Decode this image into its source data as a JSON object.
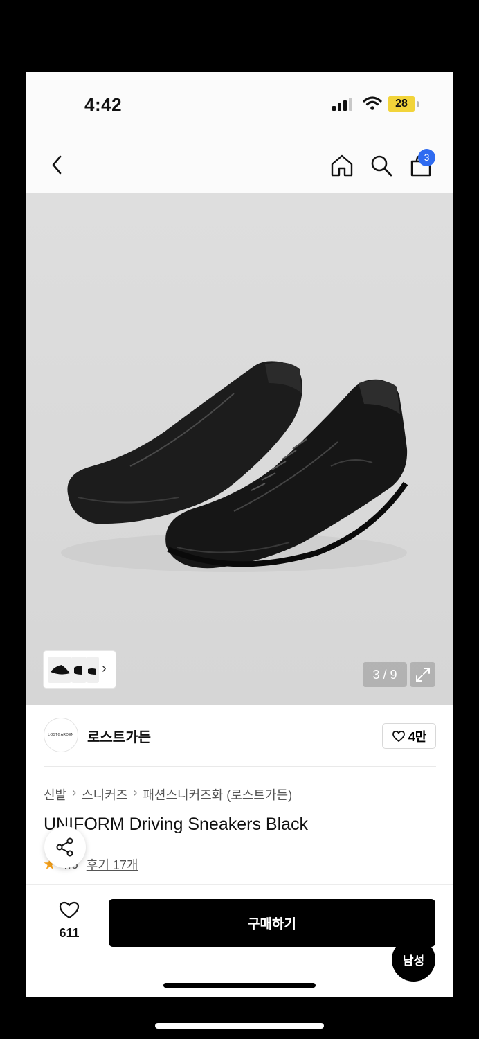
{
  "status_bar": {
    "time": "4:42",
    "battery": "28"
  },
  "nav": {
    "back_icon": "chevron-left-icon",
    "home_icon": "home-icon",
    "search_icon": "search-icon",
    "cart_icon": "shopping-bag-icon",
    "cart_badge": "3"
  },
  "gallery": {
    "counter": "3 / 9",
    "expand_icon": "expand-icon"
  },
  "brand": {
    "logo_text": "LOSTGARDEN",
    "name": "로스트가든",
    "likes": "4만"
  },
  "breadcrumb": [
    "신발",
    "스니커즈",
    "패션스니커즈화 (로스트가든)"
  ],
  "product": {
    "title": "UNIFORM Driving Sneakers Black",
    "rating": "4.6",
    "reviews": "후기 17개"
  },
  "bottom": {
    "wish_count": "611",
    "buy_label": "구매하기",
    "gender_label": "남성"
  },
  "colors": {
    "accent": "#2f6bf0",
    "star": "#f7a21b",
    "buy_bg": "#000000"
  }
}
